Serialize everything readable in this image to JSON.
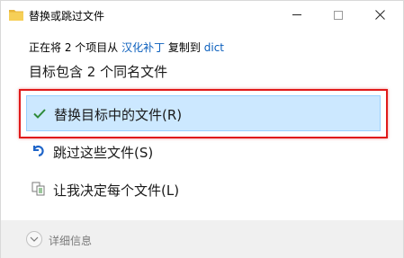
{
  "window": {
    "title": "替换或跳过文件",
    "accent": "#0b5fbd",
    "highlight_color": "#e01a1a"
  },
  "copy_info": {
    "prefix": "正在将 2 个项目从 ",
    "source": "汉化补丁",
    "middle": " 复制到 ",
    "destination": "dict"
  },
  "heading": "目标包含 2 个同名文件",
  "options": [
    {
      "label": "替换目标中的文件(R)",
      "icon": "check-icon",
      "selected": true
    },
    {
      "label": "跳过这些文件(S)",
      "icon": "skip-arrow-icon",
      "selected": false
    },
    {
      "label": "让我决定每个文件(L)",
      "icon": "compare-files-icon",
      "selected": false
    }
  ],
  "footer": {
    "details_label": "详细信息",
    "icon": "chevron-down-icon"
  }
}
